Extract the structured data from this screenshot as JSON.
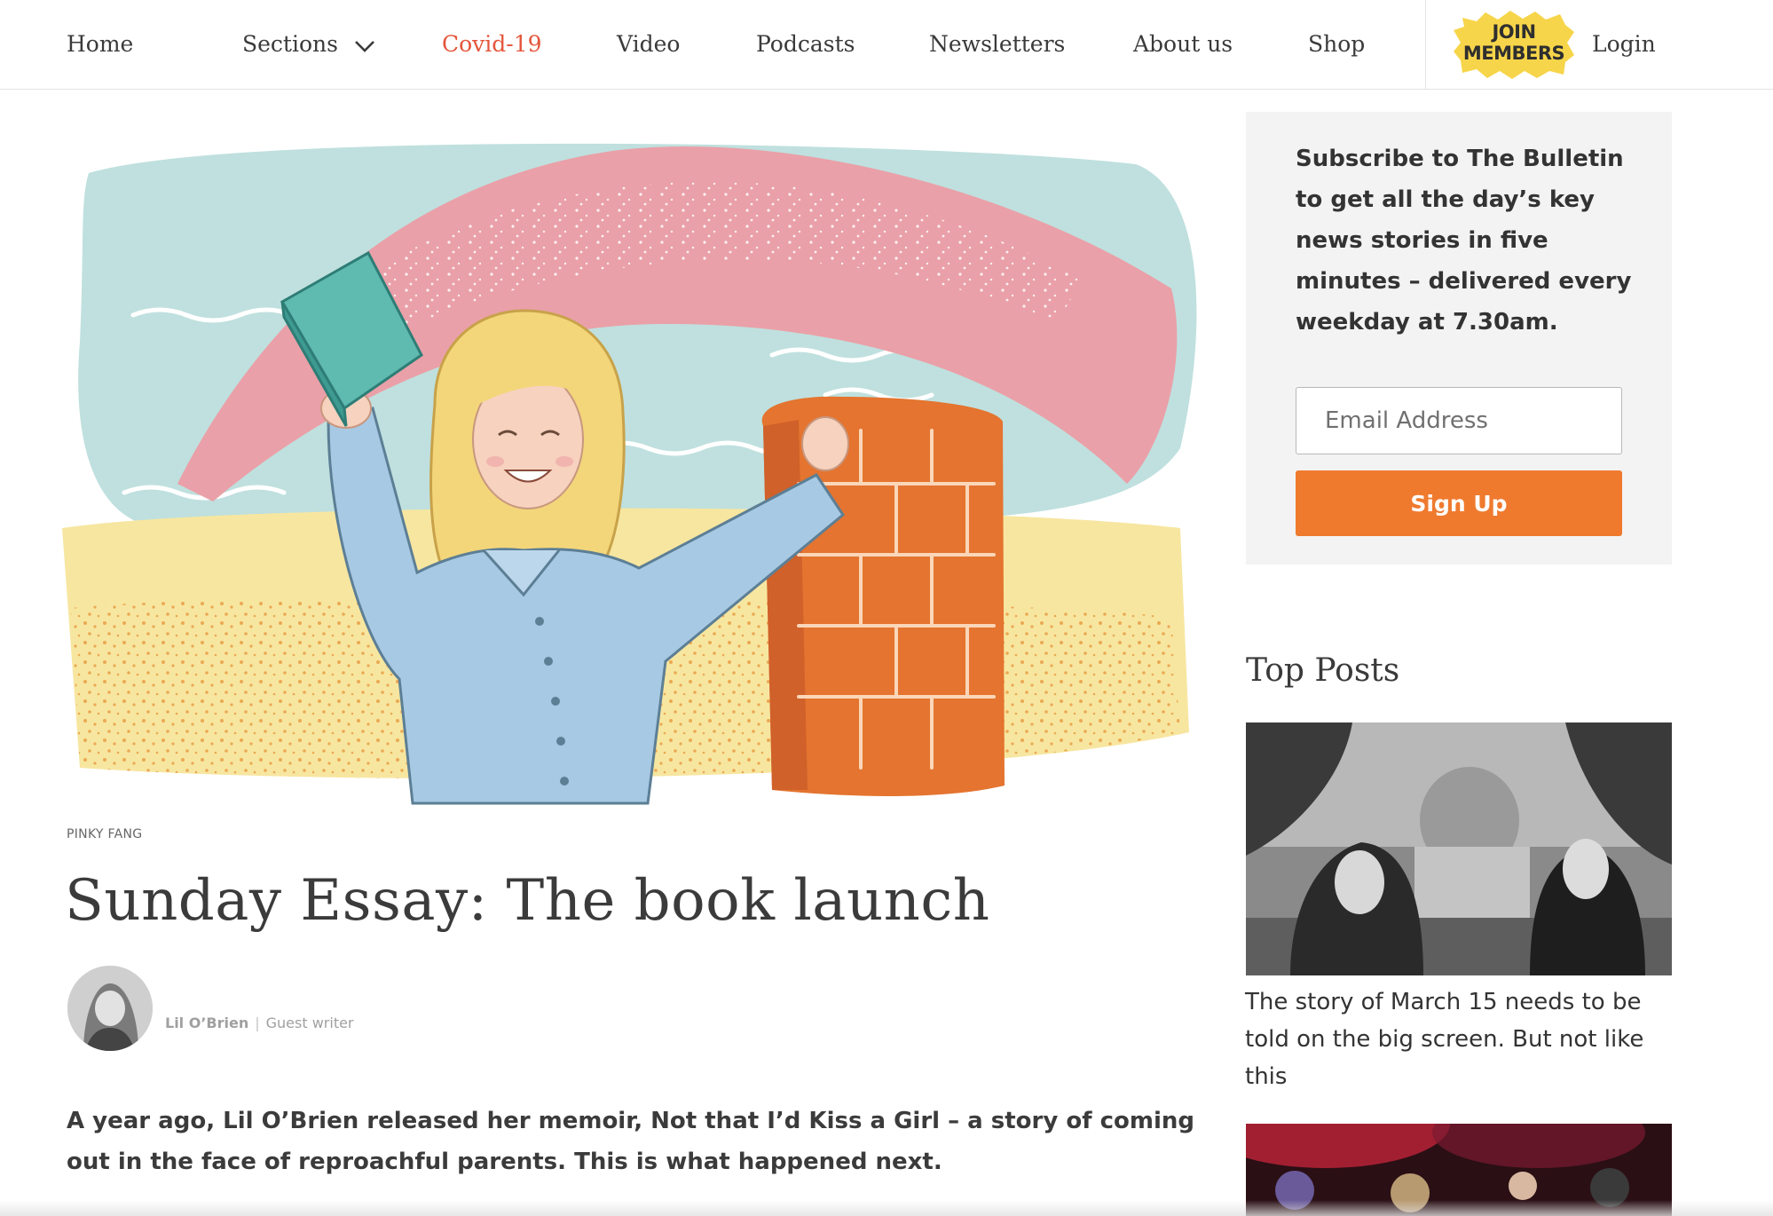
{
  "nav": {
    "items": [
      {
        "label": "Home"
      },
      {
        "label": "Sections"
      },
      {
        "label": "Covid-19"
      },
      {
        "label": "Video"
      },
      {
        "label": "Podcasts"
      },
      {
        "label": "Newsletters"
      },
      {
        "label": "About us"
      },
      {
        "label": "Shop"
      }
    ],
    "active_color": "#e4553a",
    "join_badge": {
      "line1": "JOIN",
      "line2": "MEMBERS",
      "color": "#f7d54a"
    },
    "login_label": "Login"
  },
  "article": {
    "image_credit": "PINKY FANG",
    "title": "Sunday Essay: The book launch",
    "author": "Lil O’Brien",
    "byline_separator": "|",
    "author_role": "Guest writer",
    "standfirst": "A year ago, Lil O’Brien released her memoir, Not that I’d Kiss a Girl  – a story of coming out in the face of reproachful parents. This is what happened next."
  },
  "sidebar": {
    "subscribe": {
      "text": "Subscribe to The Bulletin to get all the day’s key news stories in five minutes – delivered every weekday at 7.30am.",
      "email_placeholder": "Email Address",
      "button_label": "Sign Up",
      "button_color": "#ef7a2e"
    },
    "top_posts": {
      "heading": "Top Posts",
      "posts": [
        {
          "title": "The story of March 15 needs to be told on the big screen. But not like this"
        }
      ]
    }
  }
}
